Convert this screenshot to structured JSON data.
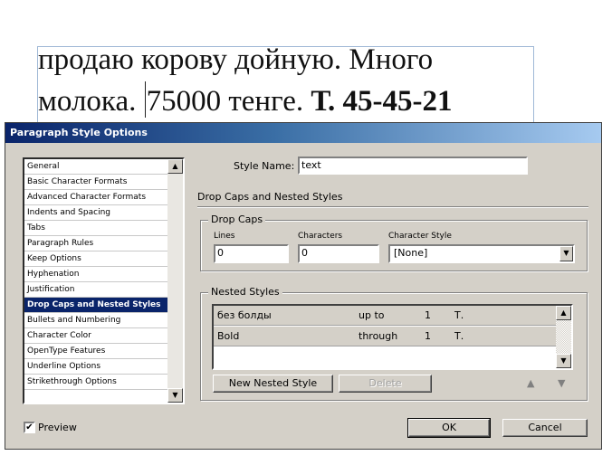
{
  "document": {
    "line1": "продаю корову дойную. Много",
    "line2_part1": "молока.",
    "line2_part2": "75000 тенге.",
    "line2_bold": "Т. 45-45-21"
  },
  "dialog": {
    "title": "Paragraph Style Options",
    "categories": [
      "General",
      "Basic Character Formats",
      "Advanced Character Formats",
      "Indents and Spacing",
      "Tabs",
      "Paragraph Rules",
      "Keep Options",
      "Hyphenation",
      "Justification",
      "Drop Caps and Nested Styles",
      "Bullets and Numbering",
      "Character Color",
      "OpenType Features",
      "Underline Options",
      "Strikethrough Options"
    ],
    "selected_category": "Drop Caps and Nested Styles",
    "style_name_label": "Style Name:",
    "style_name_value": "text",
    "section_title": "Drop Caps and Nested Styles",
    "drop_caps": {
      "group_title": "Drop Caps",
      "lines_label": "Lines",
      "lines_value": "0",
      "characters_label": "Characters",
      "characters_value": "0",
      "character_style_label": "Character Style",
      "character_style_value": "[None]"
    },
    "nested_styles": {
      "group_title": "Nested Styles",
      "rows": [
        {
          "style": "без болды",
          "mode": "up to",
          "count": "1",
          "delimiter": "Т."
        },
        {
          "style": "Bold",
          "mode": "through",
          "count": "1",
          "delimiter": "Т."
        }
      ],
      "new_button": "New Nested Style",
      "delete_button": "Delete",
      "up_arrow": "▲",
      "down_arrow": "▼"
    },
    "preview_label": "Preview",
    "preview_checked": true,
    "ok_button": "OK",
    "cancel_button": "Cancel"
  }
}
